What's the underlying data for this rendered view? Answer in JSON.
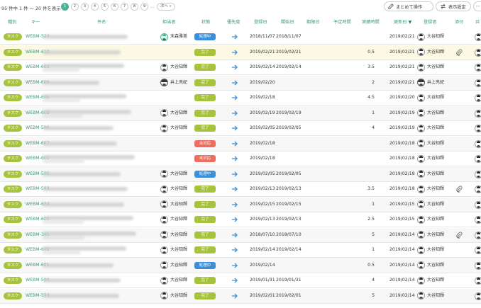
{
  "toolbar": {
    "count_text": "95 件中 1 件 ～ 20 件を表示",
    "pages": [
      "1",
      "2",
      "3",
      "4",
      "5",
      "6",
      "7",
      "8",
      "9"
    ],
    "current_page": "1",
    "ellipsis": "…",
    "next_label": "次へ »",
    "bulk_label": "まとめて操作",
    "display_label": "表示設定",
    "more_label": "···"
  },
  "columns": {
    "type": "種別",
    "key": "キー",
    "subject": "件名",
    "assignee": "担当者",
    "status": "状態",
    "priority": "優先度",
    "registered": "登録日",
    "start": "開始日",
    "due": "期限日",
    "planned": "予定時間",
    "actual": "実績時間",
    "updated": "更新日",
    "updater": "登録者",
    "attachment": "添付",
    "edge": "共"
  },
  "colors": {
    "accent": "#4cb195",
    "type_badge": "#a7c23c",
    "status_done": "#a7c23c",
    "status_in_progress": "#3b8fd9",
    "status_not_started": "#ee6d5d",
    "priority_arrow": "#3b8fd9"
  },
  "rows": [
    {
      "type": "タスク",
      "key": "WEBM-524",
      "subject_width": 120,
      "subject_lines": 1,
      "assignee": "末森雅美",
      "avatar": "green",
      "status": "処理中",
      "status_kind": "in_progress",
      "registered": "2018/11/07",
      "start": "2018/11/07",
      "due": "",
      "planned": "",
      "actual": "",
      "updated": "2019/02/21",
      "updater": "大谷知輝",
      "updater_avatar": "man",
      "attachment": false,
      "style": ""
    },
    {
      "type": "タスク",
      "key": "WEBM-610",
      "subject_width": 110,
      "subject_lines": 1,
      "assignee": "",
      "avatar": "",
      "status": "完了",
      "status_kind": "done",
      "registered": "2019/02/21",
      "start": "2019/02/21",
      "due": "",
      "planned": "",
      "actual": "0.5",
      "updated": "2019/02/21",
      "updater": "大谷知輝",
      "updater_avatar": "man",
      "attachment": true,
      "style": "highlight"
    },
    {
      "type": "タスク",
      "key": "WEBM-603",
      "subject_width": 115,
      "subject_lines": 2,
      "assignee": "大谷知輝",
      "avatar": "man",
      "status": "完了",
      "status_kind": "done",
      "registered": "2019/02/14",
      "start": "2019/02/14",
      "due": "",
      "planned": "",
      "actual": "3.5",
      "updated": "2019/02/21",
      "updater": "大谷知輝",
      "updater_avatar": "man",
      "attachment": false,
      "style": ""
    },
    {
      "type": "タスク",
      "key": "WEBM-609",
      "subject_width": 80,
      "subject_lines": 1,
      "assignee": "井上亮紀",
      "avatar": "bear",
      "status": "完了",
      "status_kind": "done",
      "registered": "2019/02/20",
      "start": "",
      "due": "",
      "planned": "",
      "actual": "2",
      "updated": "2019/02/21",
      "updater": "井上亮紀",
      "updater_avatar": "bear",
      "attachment": false,
      "style": "alt"
    },
    {
      "type": "タスク",
      "key": "WEBM-606",
      "subject_width": 118,
      "subject_lines": 2,
      "assignee": "",
      "avatar": "",
      "status": "完了",
      "status_kind": "done",
      "registered": "2019/02/18",
      "start": "",
      "due": "",
      "planned": "",
      "actual": "4.5",
      "updated": "2019/02/20",
      "updater": "大谷知輝",
      "updater_avatar": "man",
      "attachment": false,
      "style": ""
    },
    {
      "type": "タスク",
      "key": "WEBM-608",
      "subject_width": 125,
      "subject_lines": 2,
      "assignee": "大谷知輝",
      "avatar": "man",
      "status": "完了",
      "status_kind": "done",
      "registered": "2019/02/19",
      "start": "2019/02/19",
      "due": "",
      "planned": "",
      "actual": "1",
      "updated": "2019/02/19",
      "updater": "大谷知輝",
      "updater_avatar": "man",
      "attachment": false,
      "style": "alt"
    },
    {
      "type": "タスク",
      "key": "WEBM-596",
      "subject_width": 100,
      "subject_lines": 1,
      "assignee": "大谷知輝",
      "avatar": "man",
      "status": "完了",
      "status_kind": "done",
      "registered": "2019/02/05",
      "start": "2019/02/05",
      "due": "",
      "planned": "",
      "actual": "4",
      "updated": "2019/02/19",
      "updater": "大谷知輝",
      "updater_avatar": "man",
      "attachment": false,
      "style": ""
    },
    {
      "type": "タスク",
      "key": "WEBM-607",
      "subject_width": 105,
      "subject_lines": 1,
      "assignee": "",
      "avatar": "",
      "status": "未対応",
      "status_kind": "not_started",
      "registered": "2019/02/18",
      "start": "",
      "due": "",
      "planned": "",
      "actual": "",
      "updated": "2019/02/18",
      "updater": "大谷知輝",
      "updater_avatar": "man",
      "attachment": false,
      "style": "alt"
    },
    {
      "type": "タスク",
      "key": "WEBM-605",
      "subject_width": 130,
      "subject_lines": 2,
      "assignee": "",
      "avatar": "",
      "status": "未対応",
      "status_kind": "not_started",
      "registered": "2019/02/18",
      "start": "",
      "due": "",
      "planned": "",
      "actual": "",
      "updated": "2019/02/18",
      "updater": "大谷知輝",
      "updater_avatar": "man",
      "attachment": false,
      "style": ""
    },
    {
      "type": "タスク",
      "key": "WEBM-595",
      "subject_width": 110,
      "subject_lines": 1,
      "assignee": "大谷知輝",
      "avatar": "man",
      "status": "処理中",
      "status_kind": "in_progress",
      "registered": "2019/02/05",
      "start": "2019/02/05",
      "due": "",
      "planned": "",
      "actual": "",
      "updated": "2019/02/18",
      "updater": "大谷知輝",
      "updater_avatar": "man",
      "attachment": false,
      "style": "alt"
    },
    {
      "type": "タスク",
      "key": "WEBM-599",
      "subject_width": 120,
      "subject_lines": 1,
      "assignee": "大谷知輝",
      "avatar": "man",
      "status": "完了",
      "status_kind": "done",
      "registered": "2019/02/13",
      "start": "2019/02/13",
      "due": "",
      "planned": "",
      "actual": "3.5",
      "updated": "2019/02/18",
      "updater": "大谷知輝",
      "updater_avatar": "man",
      "attachment": true,
      "style": ""
    },
    {
      "type": "タスク",
      "key": "WEBM-604",
      "subject_width": 115,
      "subject_lines": 1,
      "assignee": "大谷知輝",
      "avatar": "man",
      "status": "完了",
      "status_kind": "done",
      "registered": "2019/02/15",
      "start": "2019/02/15",
      "due": "",
      "planned": "",
      "actual": "1",
      "updated": "2019/02/15",
      "updater": "大谷知輝",
      "updater_avatar": "man",
      "attachment": false,
      "style": "alt"
    },
    {
      "type": "タスク",
      "key": "WEBM-600",
      "subject_width": 128,
      "subject_lines": 2,
      "assignee": "大谷知輝",
      "avatar": "man",
      "status": "完了",
      "status_kind": "done",
      "registered": "2019/02/13",
      "start": "2019/02/13",
      "due": "",
      "planned": "",
      "actual": "2.5",
      "updated": "2019/02/15",
      "updater": "大谷知輝",
      "updater_avatar": "man",
      "attachment": false,
      "style": ""
    },
    {
      "type": "タスク",
      "key": "WEBM-385",
      "subject_width": 132,
      "subject_lines": 2,
      "assignee": "大谷知輝",
      "avatar": "man",
      "status": "完了",
      "status_kind": "done",
      "registered": "2018/07/10",
      "start": "2018/07/10",
      "due": "",
      "planned": "",
      "actual": "5",
      "updated": "2019/02/14",
      "updater": "大谷知輝",
      "updater_avatar": "man",
      "attachment": true,
      "style": "alt"
    },
    {
      "type": "タスク",
      "key": "WEBM-602",
      "subject_width": 118,
      "subject_lines": 2,
      "assignee": "大谷知輝",
      "avatar": "man",
      "status": "完了",
      "status_kind": "done",
      "registered": "2019/02/14",
      "start": "2019/02/14",
      "due": "",
      "planned": "",
      "actual": "1",
      "updated": "2019/02/14",
      "updater": "大谷知輝",
      "updater_avatar": "man",
      "attachment": false,
      "style": ""
    },
    {
      "type": "タスク",
      "key": "WEBM-601",
      "subject_width": 100,
      "subject_lines": 1,
      "assignee": "大谷知輝",
      "avatar": "man",
      "status": "処理中",
      "status_kind": "in_progress",
      "registered": "2019/02/14",
      "start": "",
      "due": "",
      "planned": "",
      "actual": "0.5",
      "updated": "2019/02/14",
      "updater": "大谷知輝",
      "updater_avatar": "man",
      "attachment": false,
      "style": "alt"
    },
    {
      "type": "タスク",
      "key": "WEBM-590",
      "subject_width": 110,
      "subject_lines": 1,
      "assignee": "大谷知輝",
      "avatar": "man",
      "status": "完了",
      "status_kind": "done",
      "registered": "2019/01/31",
      "start": "2019/01/31",
      "due": "",
      "planned": "",
      "actual": "4",
      "updated": "2019/02/14",
      "updater": "大谷知輝",
      "updater_avatar": "man",
      "attachment": false,
      "style": ""
    },
    {
      "type": "タスク",
      "key": "WEBM-593",
      "subject_width": 108,
      "subject_lines": 1,
      "assignee": "大谷知輝",
      "avatar": "man",
      "status": "完了",
      "status_kind": "done",
      "registered": "2019/02/01",
      "start": "2019/02/01",
      "due": "",
      "planned": "",
      "actual": "5",
      "updated": "2019/02/14",
      "updater": "大谷知輝",
      "updater_avatar": "man",
      "attachment": false,
      "style": "alt"
    }
  ]
}
